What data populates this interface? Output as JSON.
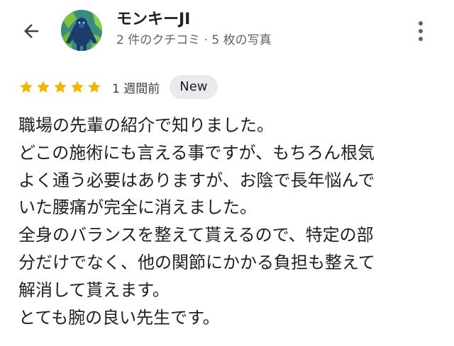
{
  "header": {
    "back_icon": "arrow-back-icon",
    "reviewer_name": "モンキーJI",
    "reviewer_meta": "2 件のクチコミ · 5 枚の写真",
    "more_icon": "more-vert-icon"
  },
  "review": {
    "rating": 5,
    "rating_max": 5,
    "star_color": "#f4b400",
    "time": "1 週間前",
    "badge": "New",
    "lines": [
      "職場の先輩の紹介で知りました。",
      "どこの施術にも言える事ですが、もちろん根気",
      "よく通う必要はありますが、お陰で長年悩んで",
      "いた腰痛が完全に消えました。",
      "全身のバランスを整えて貰えるので、特定の部",
      "分だけでなく、他の関節にかかる負担も整えて",
      "解消して貰えます。",
      "とても腕の良い先生です。"
    ]
  }
}
